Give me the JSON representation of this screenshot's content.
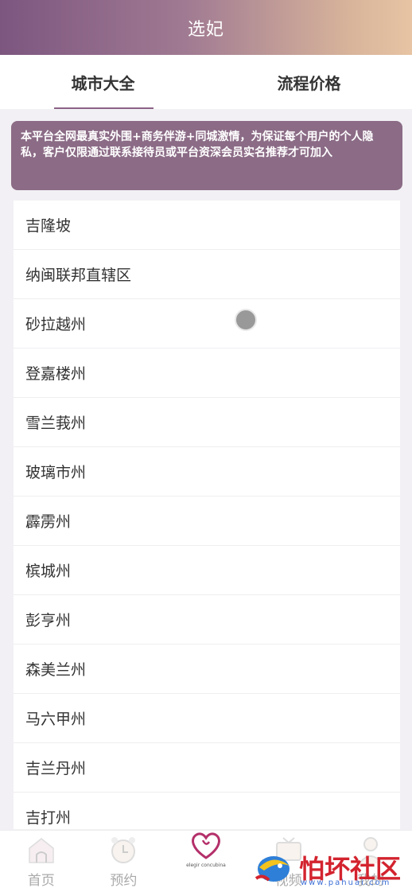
{
  "header": {
    "title": "选妃"
  },
  "tabs": [
    {
      "label": "城市大全",
      "active": true
    },
    {
      "label": "流程价格",
      "active": false
    }
  ],
  "notice": {
    "text": "本平台全网最真实外围+商务伴游+同城激情，为保证每个用户的个人隐私，客户仅限通过联系接待员或平台资深会员实名推荐才可加入"
  },
  "cities": [
    "吉隆坡",
    "纳闽联邦直辖区",
    "砂拉越州",
    "登嘉楼州",
    "雪兰莪州",
    "玻璃市州",
    "霹雳州",
    "槟城州",
    "彭亨州",
    "森美兰州",
    "马六甲州",
    "吉兰丹州",
    "吉打州"
  ],
  "tabbar": {
    "items": [
      {
        "label": "首页",
        "icon": "home-icon"
      },
      {
        "label": "预约",
        "icon": "clock-icon"
      },
      {
        "label": "",
        "icon": "logo-heart-icon",
        "logo_text": "elegir concubina"
      },
      {
        "label": "视频",
        "icon": "video-icon"
      },
      {
        "label": "我的",
        "icon": "user-icon"
      }
    ]
  },
  "watermark": {
    "text": "怕坏社区",
    "url": "www.pahuai.com"
  }
}
